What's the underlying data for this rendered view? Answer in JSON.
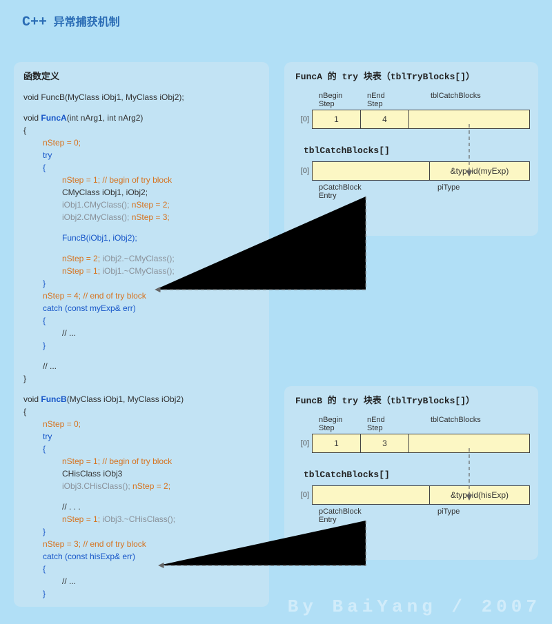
{
  "title_main": "C++",
  "title_sub": " 异常捕获机制",
  "footer": "By BaiYang / 2007",
  "code": {
    "heading": "函数定义",
    "l01": "void FuncB(MyClass iObj1, MyClass iObj2);",
    "l02": "void ",
    "l02b": "FuncA",
    "l02c": "(int nArg1, int nArg2)",
    "l03": "{",
    "l04": "nStep = 0;",
    "l05": "try",
    "l06": "{",
    "l07": "nStep = 1;",
    "l07b": " // begin of try block",
    "l08": "CMyClass iObj1, iObj2;",
    "l09": "iObj1.CMyClass(); ",
    "l09b": "nStep = 2;",
    "l10": "iObj2.CMyClass(); ",
    "l10b": "nStep = 3;",
    "l11": "FuncB(iObj1, iObj2);",
    "l12": "nStep = 2;",
    "l12b": " iObj2.~CMyClass();",
    "l13": "nStep = 1;",
    "l13b": " iObj1.~CMyClass();",
    "l14": "}",
    "l15": "nStep = 4;",
    "l15b": " // end of try block",
    "l16": "catch (const myExp& err)",
    "l17": "{",
    "l18": "// ...",
    "l19": "}",
    "l20": "// ...",
    "l21": "}",
    "l30": "void ",
    "l30b": "FuncB",
    "l30c": "(MyClass iObj1, MyClass iObj2)",
    "l31": "{",
    "l32": "nStep = 0;",
    "l33": "try",
    "l34": "{",
    "l35": "nStep = 1;",
    "l35b": " // begin of try block",
    "l36": "CHisClass iObj3",
    "l37": "iObj3.CHisClass(); ",
    "l37b": "nStep = 2;",
    "l38": "// . . .",
    "l39": "nStep = 1;",
    "l39b": " iObj3.~CHisClass();",
    "l40": "}",
    "l41": "nStep = 3;",
    "l41b": " // end of try block",
    "l42": "catch (const hisExp& err)",
    "l43": "{",
    "l44": "// ...",
    "l45": "}"
  },
  "panelA": {
    "heading": "FuncA 的 try 块表（tblTryBlocks[]）",
    "h_begin": "nBegin\nStep",
    "h_end": "nEnd\nStep",
    "h_catch": "tblCatchBlocks",
    "row_idx": "[0]",
    "cell_begin": "1",
    "cell_end": "4",
    "catch_heading": "tblCatchBlocks[]",
    "catch_row_idx": "[0]",
    "catch_typeid": "&typeid(myExp)",
    "lbl_entry": "pCatchBlock\nEntry",
    "lbl_pitype": "piType"
  },
  "panelB": {
    "heading": "FuncB 的 try 块表（tblTryBlocks[]）",
    "h_begin": "nBegin\nStep",
    "h_end": "nEnd\nStep",
    "h_catch": "tblCatchBlocks",
    "row_idx": "[0]",
    "cell_begin": "1",
    "cell_end": "3",
    "catch_heading": "tblCatchBlocks[]",
    "catch_row_idx": "[0]",
    "catch_typeid": "&typeid(hisExp)",
    "lbl_entry": "pCatchBlock\nEntry",
    "lbl_pitype": "piType"
  }
}
